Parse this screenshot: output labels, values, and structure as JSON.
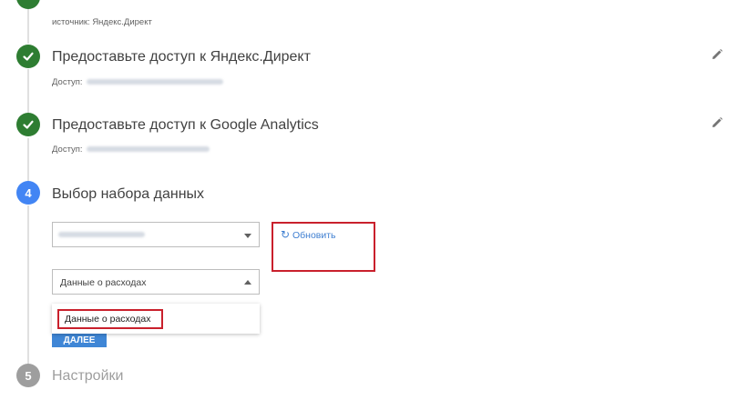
{
  "step_source": {
    "caption": "источник: Яндекс.Директ"
  },
  "step2": {
    "title": "Предоставьте доступ к Яндекс.Директ",
    "access_label": "Доступ:"
  },
  "step3": {
    "title": "Предоставьте доступ к Google Analytics",
    "access_label": "Доступ:"
  },
  "step4": {
    "number": "4",
    "title": "Выбор набора данных",
    "refresh_label": "Обновить",
    "type_select_value": "Данные о расходах",
    "dropdown_option": "Данные о расходах",
    "next_button": "ДАЛЕЕ"
  },
  "step5": {
    "number": "5",
    "title": "Настройки"
  },
  "colors": {
    "done": "#2e7d32",
    "active": "#4285f4",
    "idle": "#9e9e9e",
    "highlight_box": "#c9202c",
    "link": "#3f7fd1"
  },
  "icons": [
    "check-icon",
    "pencil-icon",
    "refresh-icon",
    "chevron-down-icon",
    "chevron-up-icon"
  ]
}
